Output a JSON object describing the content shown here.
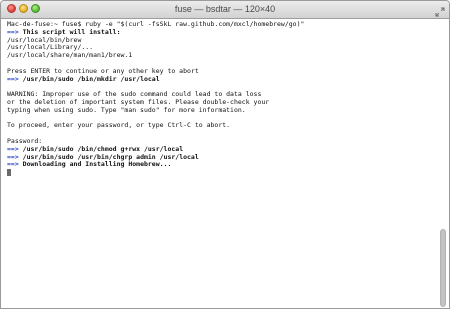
{
  "window": {
    "title": "fuse — bsdtar — 120×40"
  },
  "terminal": {
    "lines": [
      {
        "prefix": "",
        "text": "Mac-de-fuse:~ fuse$ ruby -e \"$(curl -fsSkL raw.github.com/mxcl/homebrew/go)\""
      },
      {
        "prefix": "==>",
        "text": " This script will install:"
      },
      {
        "prefix": "",
        "text": "/usr/local/bin/brew"
      },
      {
        "prefix": "",
        "text": "/usr/local/Library/..."
      },
      {
        "prefix": "",
        "text": "/usr/local/share/man/man1/brew.1"
      },
      {
        "prefix": "",
        "text": ""
      },
      {
        "prefix": "",
        "text": "Press ENTER to continue or any other key to abort"
      },
      {
        "prefix": "==>",
        "text": " /usr/bin/sudo /bin/mkdir /usr/local"
      },
      {
        "prefix": "",
        "text": ""
      },
      {
        "prefix": "",
        "text": "WARNING: Improper use of the sudo command could lead to data loss"
      },
      {
        "prefix": "",
        "text": "or the deletion of important system files. Please double-check your"
      },
      {
        "prefix": "",
        "text": "typing when using sudo. Type \"man sudo\" for more information."
      },
      {
        "prefix": "",
        "text": ""
      },
      {
        "prefix": "",
        "text": "To proceed, enter your password, or type Ctrl-C to abort."
      },
      {
        "prefix": "",
        "text": ""
      },
      {
        "prefix": "",
        "text": "Password:"
      },
      {
        "prefix": "==>",
        "text": " /usr/bin/sudo /bin/chmod g+rwx /usr/local"
      },
      {
        "prefix": "==>",
        "text": " /usr/bin/sudo /usr/bin/chgrp admin /usr/local"
      },
      {
        "prefix": "==>",
        "text": " Downloading and Installing Homebrew..."
      }
    ]
  },
  "scrollbar": {
    "position_fraction": 1.0,
    "visible_fraction": 0.27
  },
  "colors": {
    "arrow": "#2a44c8",
    "text": "#111111",
    "background": "#ffffff"
  },
  "icons": {
    "close": "close-icon",
    "minimize": "minimize-icon",
    "zoom": "zoom-icon",
    "fullscreen": "fullscreen-arrows-icon"
  }
}
